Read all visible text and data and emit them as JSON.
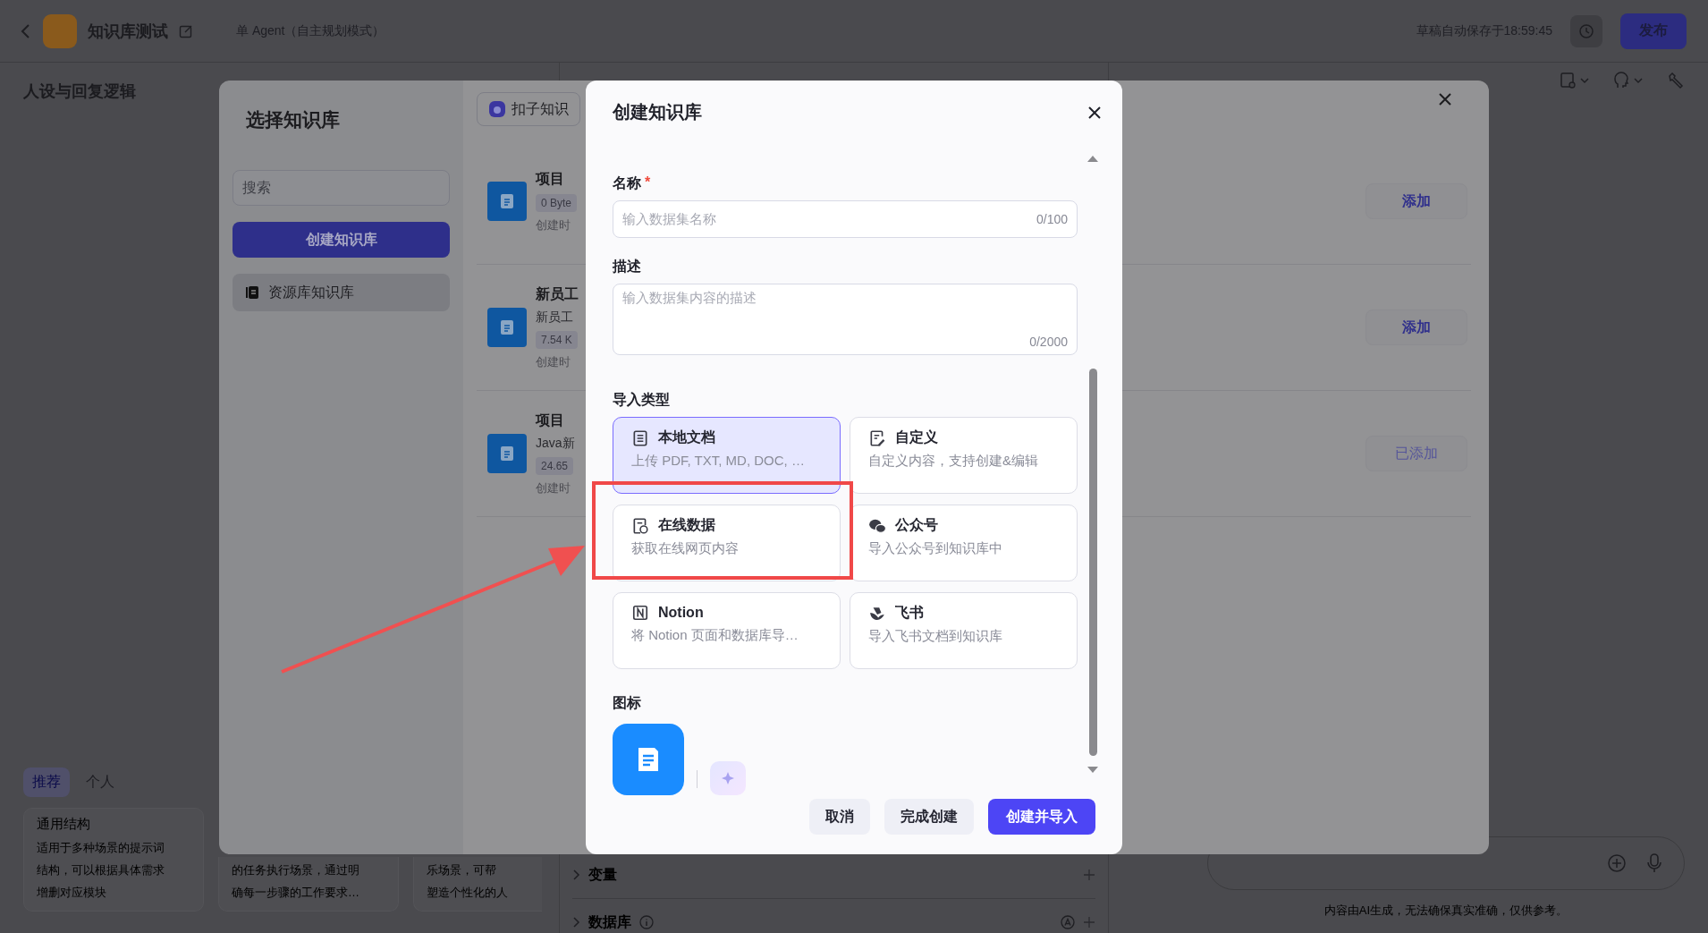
{
  "topbar": {
    "title": "知识库测试",
    "mode": "单 Agent（自主规划模式）",
    "autosave": "草稿自动保存于18:59:45",
    "publish": "发布"
  },
  "prompt": {
    "title": "人设与回复逻辑",
    "tabs": [
      {
        "label": "推荐",
        "selected": true
      },
      {
        "label": "个人",
        "selected": false
      }
    ],
    "templates": [
      {
        "title": "通用结构",
        "lines": [
          "适用于多种场景的提示词",
          "结构，可以根据具体需求",
          "增删对应模块"
        ]
      },
      {
        "lines": [
          "的任务执行场景，通过明",
          "确每一步骤的工作要求…"
        ]
      },
      {
        "lines": [
          "乐场景，可帮",
          "塑造个性化的人"
        ]
      }
    ]
  },
  "config_rows": [
    {
      "label": "变量",
      "info": false,
      "auto": false
    },
    {
      "label": "数据库",
      "info": true,
      "auto": true
    }
  ],
  "chat": {
    "disclaimer": "内容由AI生成，无法确保真实准确，仅供参考。"
  },
  "select_dialog": {
    "title": "选择知识库",
    "search_placeholder": "搜索",
    "create_button": "创建知识库",
    "nav": [
      {
        "label": "资源库知识库",
        "selected": true
      }
    ],
    "source_chip": "扣子知识",
    "items": [
      {
        "title": "项目",
        "size": "0 Byte",
        "created": "创建时",
        "action": "添加",
        "added": false
      },
      {
        "title": "新员工",
        "description": "新员工",
        "size": "7.54 K",
        "created": "创建时",
        "action": "添加",
        "added": false
      },
      {
        "title": "项目",
        "description": "Java新",
        "size": "24.65",
        "created": "创建时",
        "action": "已添加",
        "added": true
      }
    ]
  },
  "create_dialog": {
    "title": "创建知识库",
    "fields": [
      {
        "kind": "input",
        "label": "名称",
        "required_mark": "*",
        "placeholder": "输入数据集名称",
        "counter": "0/100"
      },
      {
        "kind": "textarea",
        "label": "描述",
        "placeholder": "输入数据集内容的描述",
        "counter": "0/2000"
      }
    ],
    "import_label": "导入类型",
    "import_types": [
      {
        "kind": "local",
        "title": "本地文档",
        "description": "上传 PDF, TXT, MD, DOC, …",
        "selected": true
      },
      {
        "kind": "custom",
        "title": "自定义",
        "description": "自定义内容，支持创建&编辑",
        "selected": false
      },
      {
        "kind": "online",
        "title": "在线数据",
        "description": "获取在线网页内容",
        "selected": false
      },
      {
        "kind": "wechat",
        "title": "公众号",
        "description": "导入公众号到知识库中",
        "selected": false
      },
      {
        "kind": "notion",
        "title": "Notion",
        "description": "将 Notion 页面和数据库导…",
        "selected": false
      },
      {
        "kind": "feishu",
        "title": "飞书",
        "description": "导入飞书文档到知识库",
        "selected": false
      }
    ],
    "icon_label": "图标",
    "buttons": [
      {
        "kind": "secondary",
        "label": "取消"
      },
      {
        "kind": "secondary",
        "label": "完成创建"
      },
      {
        "kind": "primary",
        "label": "创建并导入"
      }
    ]
  }
}
